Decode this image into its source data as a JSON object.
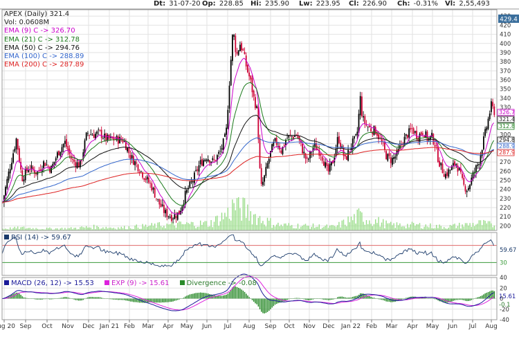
{
  "header": {
    "date_label": "Dt:",
    "date": "31-07-20",
    "open_label": "Op:",
    "open": "228.85",
    "high_label": "Hi:",
    "high": "235.90",
    "low_label": "Lw:",
    "low": "223.95",
    "close_label": "Cl:",
    "close": "226.90",
    "change_label": "Ch:",
    "change": "-0.31%",
    "volume_label": "Vl:",
    "volume": "2,55,493"
  },
  "legend": {
    "title": "APEX (Daily) 321.4",
    "vol": "Vol: 0.0608M",
    "ema9": "EMA (9) C -> 326.70",
    "ema21": "EMA (21) C -> 312.78",
    "ema50": "EMA (50) C -> 294.76",
    "ema100": "EMA (100) C -> 288.89",
    "ema200": "EMA (200) C -> 287.89"
  },
  "rsi_legend": "RSI (14) -> 59.67",
  "macd_legend": {
    "macd": "MACD (26, 12) -> 15.53",
    "exp": "EXP (9) -> 15.61",
    "div": "Divergence -> -0.08"
  },
  "colors": {
    "up": "#000000",
    "down": "#cc0033",
    "ema9": "#cc00cc",
    "ema21": "#1a7a1a",
    "ema50": "#111111",
    "ema100": "#3366cc",
    "ema200": "#dd2222",
    "volume": "#99dd88",
    "rsi": "#1a3a6a",
    "macd": "#1a1a99",
    "exp": "#dd22dd",
    "div": "#2a8a2a",
    "grid": "#e2e2e2"
  },
  "chart_data": [
    {
      "type": "candlestick",
      "title": "APEX (Daily) 321.4",
      "x_ticks": [
        "Aug 20",
        "Sep",
        "Oct",
        "Nov",
        "Dec",
        "Jan 21",
        "Feb",
        "Mar",
        "Apr",
        "May",
        "Jun",
        "Jul",
        "Aug",
        "Sep",
        "Oct",
        "Nov",
        "Dec",
        "Jan 22",
        "Feb",
        "Mar",
        "Apr",
        "May",
        "Jun",
        "Jul",
        "Aug"
      ],
      "y_ticks": [
        200,
        210,
        220,
        230,
        240,
        250,
        260,
        270,
        280,
        290,
        300,
        310,
        320,
        330,
        340,
        350,
        360,
        370,
        380,
        390,
        400,
        410,
        420,
        430
      ],
      "ylim": [
        195,
        437
      ],
      "last_price": 429.4,
      "price_labels": [
        "326.7",
        "321.4",
        "312.8",
        "294.8",
        "288.9",
        "287.9"
      ],
      "close_path": [
        [
          0,
          226
        ],
        [
          10,
          262
        ],
        [
          20,
          296
        ],
        [
          28,
          252
        ],
        [
          38,
          264
        ],
        [
          50,
          258
        ],
        [
          60,
          270
        ],
        [
          70,
          262
        ],
        [
          80,
          280
        ],
        [
          90,
          292
        ],
        [
          100,
          272
        ],
        [
          112,
          266
        ],
        [
          122,
          302
        ],
        [
          132,
          300
        ],
        [
          140,
          302
        ],
        [
          150,
          295
        ],
        [
          162,
          295
        ],
        [
          175,
          294
        ],
        [
          185,
          276
        ],
        [
          195,
          266
        ],
        [
          205,
          254
        ],
        [
          215,
          244
        ],
        [
          225,
          226
        ],
        [
          235,
          214
        ],
        [
          245,
          210
        ],
        [
          255,
          214
        ],
        [
          265,
          236
        ],
        [
          275,
          250
        ],
        [
          285,
          268
        ],
        [
          295,
          276
        ],
        [
          305,
          270
        ],
        [
          315,
          282
        ],
        [
          323,
          300
        ],
        [
          328,
          360
        ],
        [
          333,
          416
        ],
        [
          338,
          386
        ],
        [
          343,
          400
        ],
        [
          348,
          390
        ],
        [
          353,
          372
        ],
        [
          358,
          360
        ],
        [
          363,
          340
        ],
        [
          368,
          326
        ],
        [
          373,
          240
        ],
        [
          378,
          252
        ],
        [
          383,
          268
        ],
        [
          388,
          282
        ],
        [
          393,
          292
        ],
        [
          398,
          290
        ],
        [
          403,
          282
        ],
        [
          410,
          296
        ],
        [
          418,
          298
        ],
        [
          425,
          300
        ],
        [
          432,
          286
        ],
        [
          440,
          270
        ],
        [
          450,
          288
        ],
        [
          460,
          280
        ],
        [
          470,
          258
        ],
        [
          478,
          272
        ],
        [
          485,
          298
        ],
        [
          495,
          272
        ],
        [
          505,
          290
        ],
        [
          512,
          298
        ],
        [
          517,
          340
        ],
        [
          520,
          318
        ],
        [
          526,
          310
        ],
        [
          532,
          306
        ],
        [
          540,
          304
        ],
        [
          548,
          290
        ],
        [
          555,
          276
        ],
        [
          562,
          272
        ],
        [
          570,
          278
        ],
        [
          578,
          292
        ],
        [
          585,
          300
        ],
        [
          592,
          306
        ],
        [
          600,
          298
        ],
        [
          608,
          304
        ],
        [
          615,
          294
        ],
        [
          620,
          298
        ],
        [
          625,
          290
        ],
        [
          630,
          272
        ],
        [
          635,
          262
        ],
        [
          640,
          256
        ],
        [
          645,
          260
        ],
        [
          650,
          264
        ],
        [
          655,
          270
        ],
        [
          660,
          260
        ],
        [
          666,
          244
        ],
        [
          672,
          240
        ],
        [
          680,
          256
        ],
        [
          688,
          270
        ],
        [
          694,
          290
        ],
        [
          700,
          310
        ],
        [
          706,
          332
        ],
        [
          710,
          326
        ],
        [
          714,
          321.4
        ]
      ],
      "volume_path": [
        [
          0,
          0.1
        ],
        [
          30,
          0.15
        ],
        [
          60,
          0.1
        ],
        [
          100,
          0.12
        ],
        [
          130,
          0.2
        ],
        [
          170,
          0.15
        ],
        [
          230,
          0.3
        ],
        [
          300,
          0.4
        ],
        [
          328,
          1.0
        ],
        [
          335,
          1.5
        ],
        [
          375,
          0.6
        ],
        [
          400,
          0.3
        ],
        [
          440,
          0.25
        ],
        [
          480,
          0.2
        ],
        [
          515,
          0.8
        ],
        [
          560,
          0.3
        ],
        [
          600,
          0.3
        ],
        [
          640,
          0.2
        ],
        [
          690,
          0.4
        ],
        [
          710,
          0.3
        ]
      ]
    },
    {
      "type": "line",
      "name": "RSI (14)",
      "ylim": [
        0,
        100
      ],
      "y_ticks": [
        30,
        59.67
      ],
      "reference_lines": [
        30,
        70
      ],
      "current": 59.67
    },
    {
      "type": "line",
      "name": "MACD (26, 12)",
      "ylim": [
        -40,
        40
      ],
      "y_ticks": [
        -40,
        -20,
        0,
        20,
        40
      ],
      "current_macd": 15.53,
      "current_signal": 15.61,
      "current_divergence": -0.08,
      "value_labels": [
        "15.61",
        "-0.1"
      ]
    }
  ]
}
